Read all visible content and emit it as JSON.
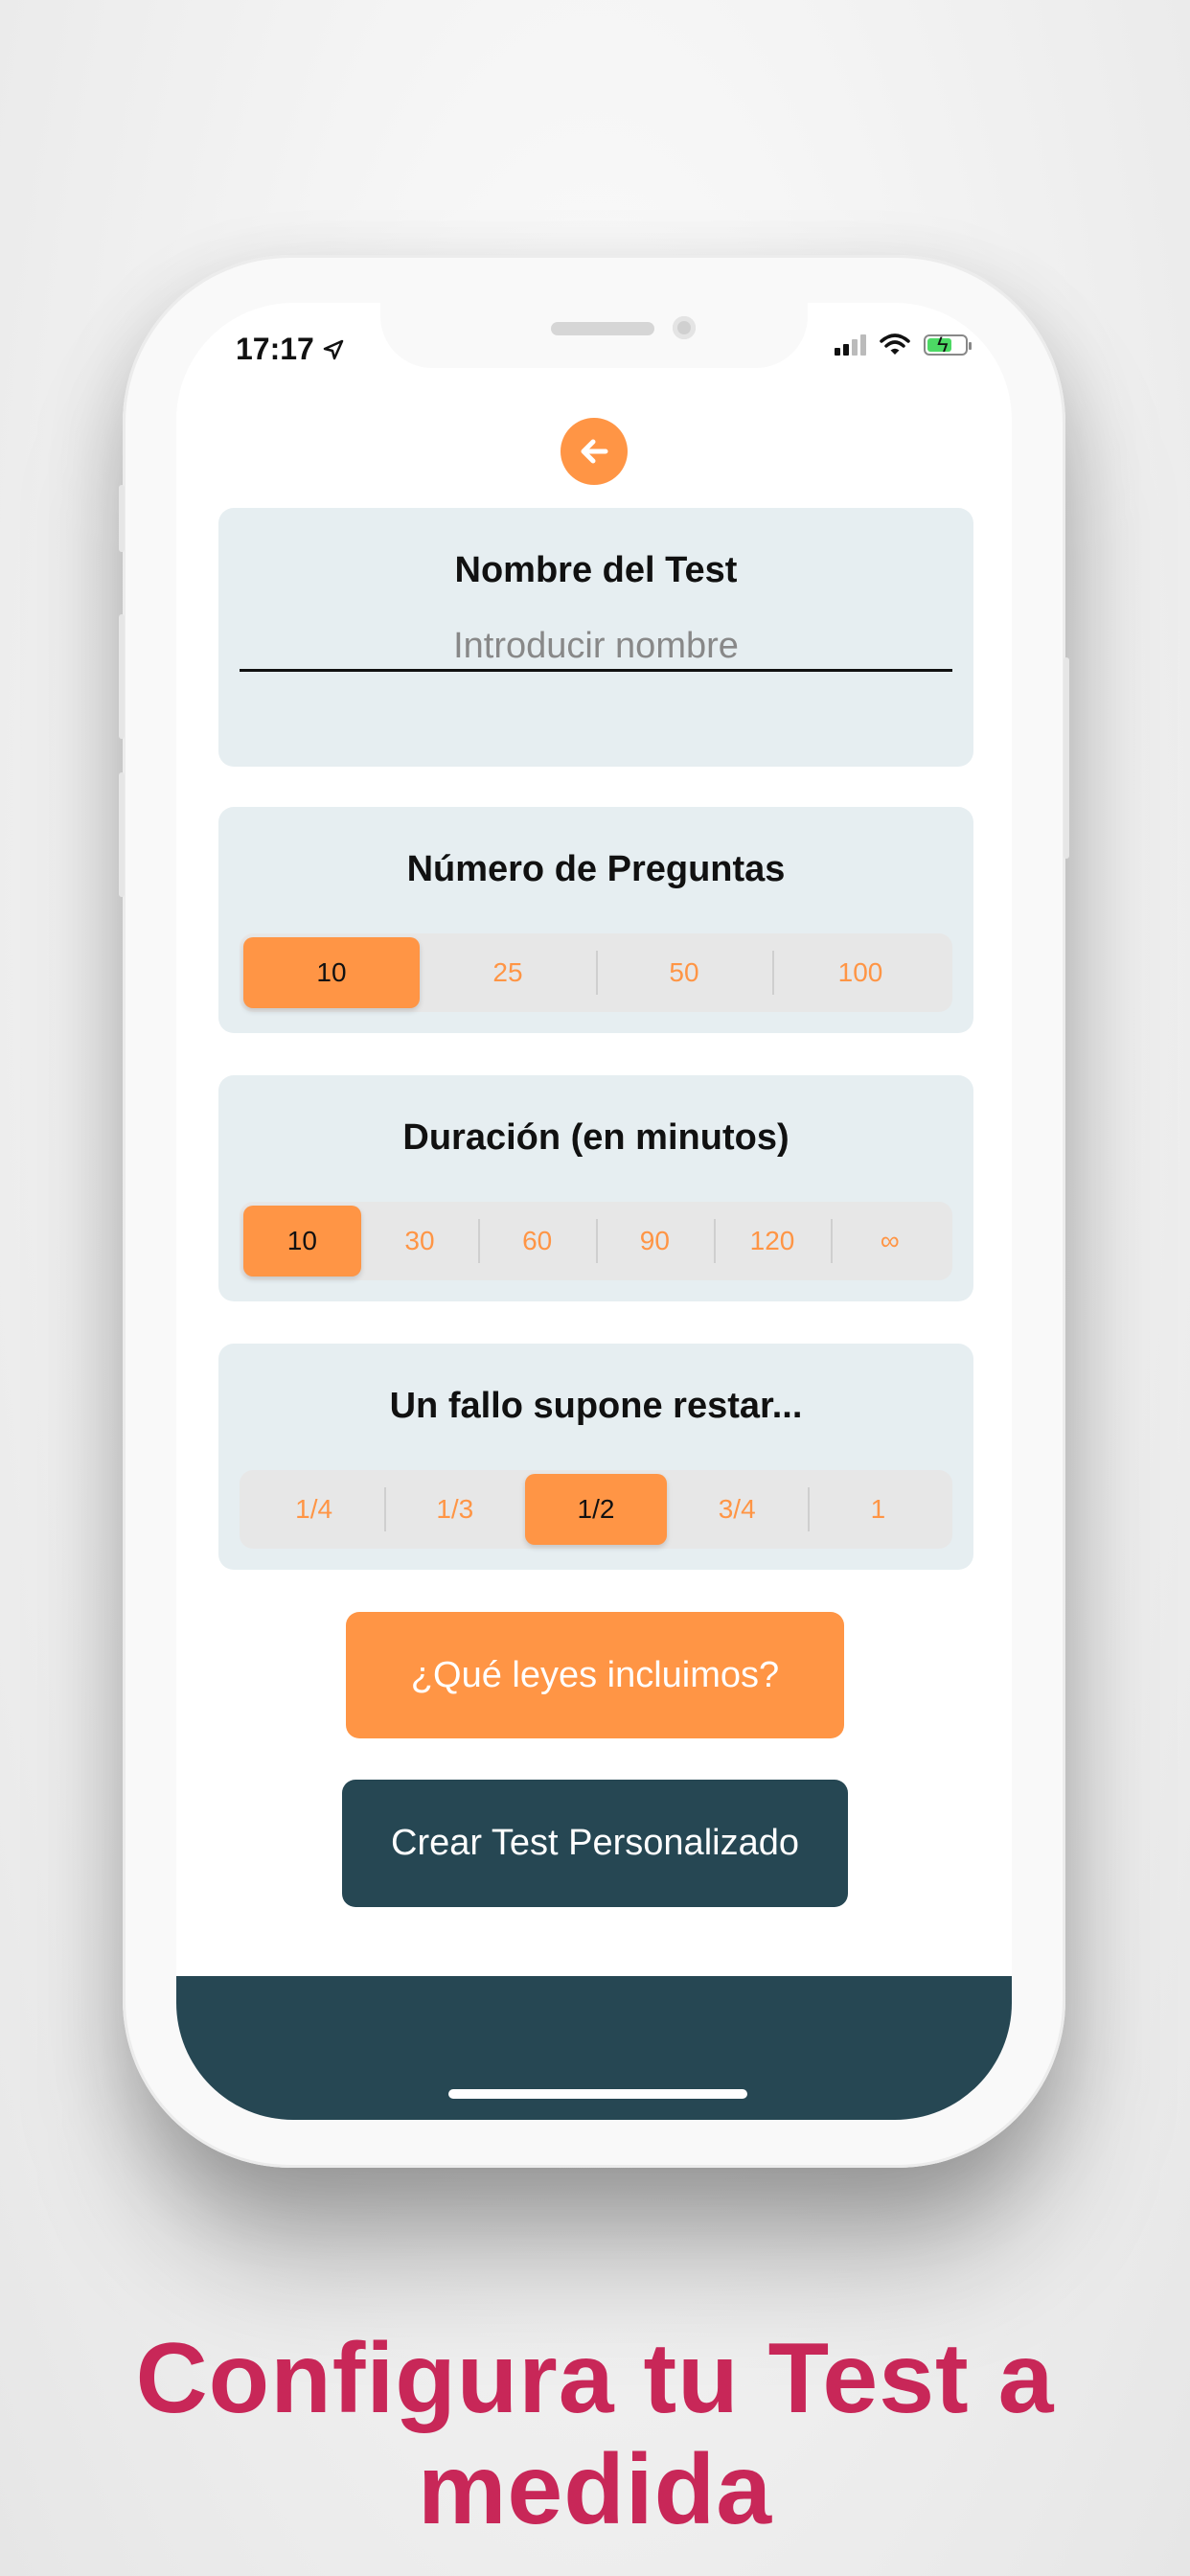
{
  "status_bar": {
    "time": "17:17"
  },
  "form": {
    "name": {
      "title": "Nombre del Test",
      "placeholder": "Introducir nombre"
    },
    "questions": {
      "title": "Número de Preguntas",
      "options": [
        "10",
        "25",
        "50",
        "100"
      ],
      "selected": "10"
    },
    "duration": {
      "title": "Duración (en minutos)",
      "options": [
        "10",
        "30",
        "60",
        "90",
        "120",
        "∞"
      ],
      "selected": "10"
    },
    "penalty": {
      "title": "Un fallo supone restar...",
      "options": [
        "1/4",
        "1/3",
        "1/2",
        "3/4",
        "1"
      ],
      "selected": "1/2"
    }
  },
  "buttons": {
    "laws": "¿Qué leyes incluimos?",
    "create": "Crear Test Personalizado"
  },
  "caption": {
    "line1": "Configura tu Test a",
    "line2": "medida"
  },
  "colors": {
    "accent": "#ff9545",
    "dark": "#264753",
    "card": "#e6eef1",
    "caption": "#c82758"
  }
}
